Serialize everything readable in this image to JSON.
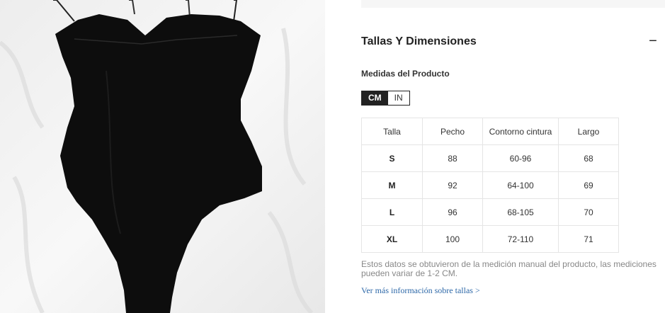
{
  "product_image": {
    "alt": "black swimsuit bodysuit on white fabric"
  },
  "size_section": {
    "title": "Tallas Y Dimensiones",
    "toggle_icon": "−",
    "subheading": "Medidas del Producto",
    "units": {
      "active": "CM",
      "inactive": "IN"
    },
    "table": {
      "headers": [
        "Talla",
        "Pecho",
        "Contorno cintura",
        "Largo"
      ],
      "rows": [
        [
          "S",
          "88",
          "60-96",
          "68"
        ],
        [
          "M",
          "92",
          "64-100",
          "69"
        ],
        [
          "L",
          "96",
          "68-105",
          "70"
        ],
        [
          "XL",
          "100",
          "72-110",
          "71"
        ]
      ]
    },
    "footnote": "Estos datos se obtuvieron de la medición manual del producto, las mediciones pueden variar de 1-2 CM.",
    "more_link": "Ver más información sobre tallas >"
  }
}
